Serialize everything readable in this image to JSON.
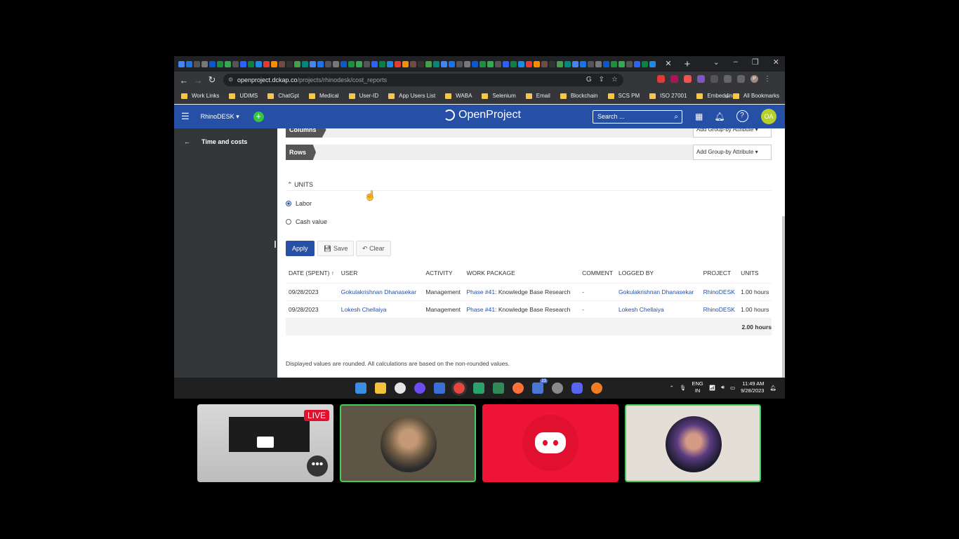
{
  "browser": {
    "url_host": "openproject.dckap.co",
    "url_path": "/projects/rhinodesk/cost_reports",
    "bookmarks": [
      "Work Links",
      "UDIMS",
      "ChatGpt",
      "Medical",
      "User-ID",
      "App Users List",
      "WABA",
      "Selenium",
      "Email",
      "Blockchain",
      "SCS PM",
      "ISO 27001",
      "Embedding"
    ],
    "bookmarks_more": "»",
    "all_bookmarks": "All Bookmarks",
    "profile_initial": "P"
  },
  "header": {
    "project": "RhinoDESK",
    "logo_text": "OpenProject",
    "search_placeholder": "Search ...",
    "avatar_initials": "OA"
  },
  "sidebar": {
    "back_arrow": "←",
    "title": "Time and costs"
  },
  "report": {
    "columns_label": "Columns",
    "rows_label": "Rows",
    "group_by_label": "Add Group-by Attribute",
    "units_heading": "UNITS",
    "units_options": [
      {
        "label": "Labor",
        "selected": true
      },
      {
        "label": "Cash value",
        "selected": false
      }
    ],
    "buttons": {
      "apply": "Apply",
      "save": "Save",
      "clear": "Clear"
    },
    "table": {
      "headers": [
        "DATE (SPENT)",
        "USER",
        "ACTIVITY",
        "WORK PACKAGE",
        "COMMENT",
        "LOGGED BY",
        "PROJECT",
        "UNITS"
      ],
      "sort_indicator": "↑",
      "rows": [
        {
          "date": "09/28/2023",
          "user": "Gokulakrishnan Dhanasekar",
          "activity": "Management",
          "wp_link": "Phase #41",
          "wp_title": ": Knowledge Base Research",
          "comment": "-",
          "logged_by": "Gokulakrishnan Dhanasekar",
          "project": "RhinoDESK",
          "units": "1.00 hours"
        },
        {
          "date": "09/28/2023",
          "user": "Lokesh Chellaiya",
          "activity": "Management",
          "wp_link": "Phase #41",
          "wp_title": ": Knowledge Base Research",
          "comment": "-",
          "logged_by": "Lokesh Chellaiya",
          "project": "RhinoDESK",
          "units": "1.00 hours"
        }
      ],
      "total": "2.00 hours"
    },
    "footnote": "Displayed values are rounded. All calculations are based on the non-rounded values."
  },
  "taskbar": {
    "lang_top": "ENG",
    "lang_bottom": "IN",
    "time": "11:49 AM",
    "date": "9/28/2023",
    "badge_count": "23"
  },
  "meeting": {
    "live_label": "LIVE",
    "more_label": "•••"
  },
  "colors": {
    "brand_blue": "#2550a5",
    "sidebar_dark": "#333739",
    "add_green": "#35c53f",
    "speaker_green": "#3ecf5b",
    "discord_red": "#ee1438"
  }
}
